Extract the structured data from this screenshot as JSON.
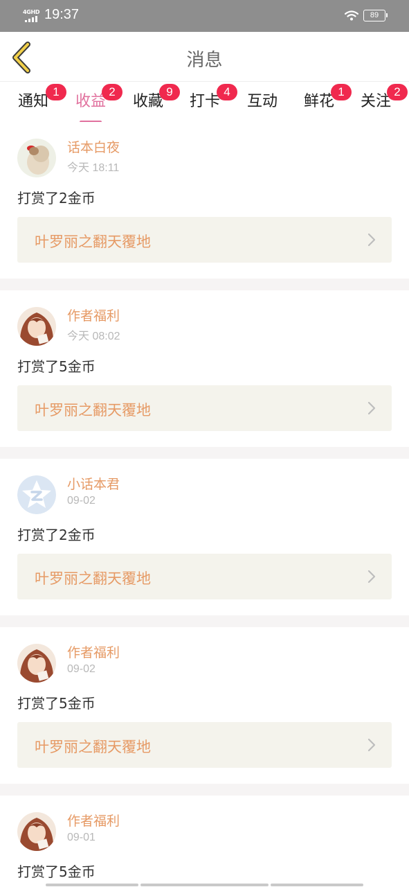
{
  "status_bar": {
    "network": "4GHD",
    "time": "19:37",
    "battery": "89"
  },
  "header": {
    "title": "消息"
  },
  "tabs": [
    {
      "label": "通知",
      "badge": "1",
      "active": false
    },
    {
      "label": "收益",
      "badge": "2",
      "active": true
    },
    {
      "label": "收藏",
      "badge": "9",
      "active": false
    },
    {
      "label": "打卡",
      "badge": "4",
      "active": false
    },
    {
      "label": "互动",
      "badge": "",
      "active": false
    },
    {
      "label": "鲜花",
      "badge": "1",
      "active": false
    },
    {
      "label": "关注",
      "badge": "2",
      "active": false
    }
  ],
  "messages": [
    {
      "name": "话本白夜",
      "time": "今天 18:11",
      "action": "打赏了2金币",
      "book": "叶罗丽之翻天覆地",
      "avatar": "girl-photo-avatar"
    },
    {
      "name": "作者福利",
      "time": "今天 08:02",
      "action": "打赏了5金币",
      "book": "叶罗丽之翻天覆地",
      "avatar": "anime-girl-avatar"
    },
    {
      "name": "小话本君",
      "time": "09-02",
      "action": "打赏了2金币",
      "book": "叶罗丽之翻天覆地",
      "avatar": "star-logo-avatar"
    },
    {
      "name": "作者福利",
      "time": "09-02",
      "action": "打赏了5金币",
      "book": "叶罗丽之翻天覆地",
      "avatar": "anime-girl-avatar"
    },
    {
      "name": "作者福利",
      "time": "09-01",
      "action": "打赏了5金币",
      "book": "",
      "avatar": "anime-girl-avatar"
    }
  ],
  "colors": {
    "accent_pink": "#e1719e",
    "name_orange": "#e69a65",
    "badge_red": "#f0294e",
    "book_bg": "#f4f3ec"
  }
}
